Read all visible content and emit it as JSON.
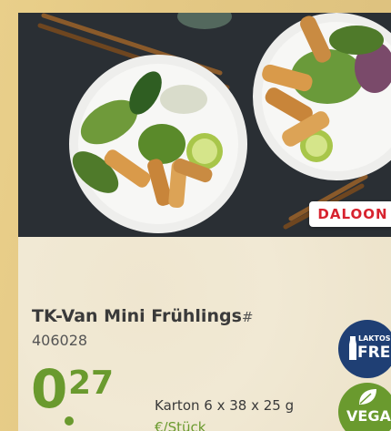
{
  "product": {
    "brand_logo_text": "DALOON",
    "name": "TK-Van Mini Frühlings",
    "name_suffix": "#",
    "article_number": "406028",
    "price_euro": "0",
    "price_cents": "27",
    "package": "Karton 6 x 38 x 25 g",
    "unit": "€/Stück"
  },
  "badges": {
    "lactose_small": "LAKTOSE",
    "lactose_big": "FREI",
    "vegan": "VEGAN"
  },
  "colors": {
    "price_green": "#6a9a2e",
    "lactose_blue": "#1f3f74",
    "brand_red": "#d7232f",
    "background_gold": "#e4c884"
  },
  "icons": [
    "milk-bottle-icon",
    "leaf-icon"
  ]
}
